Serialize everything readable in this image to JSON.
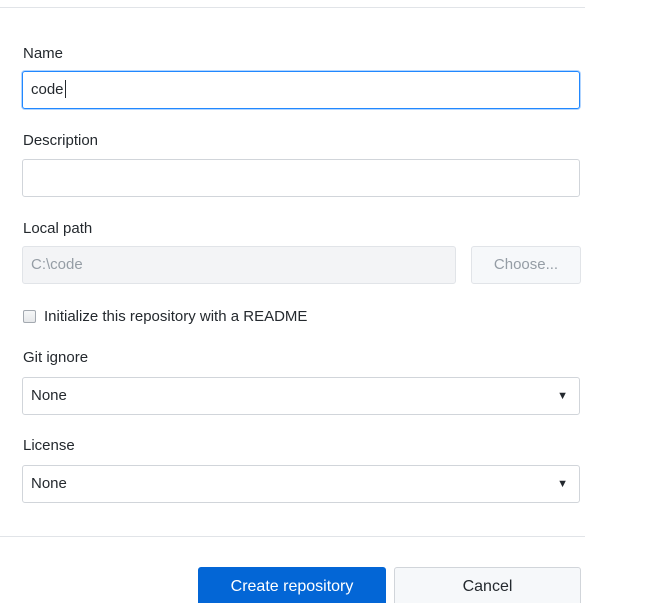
{
  "form": {
    "name": {
      "label": "Name",
      "value": "code"
    },
    "description": {
      "label": "Description",
      "value": ""
    },
    "local_path": {
      "label": "Local path",
      "value": "C:\\code",
      "choose_label": "Choose..."
    },
    "readme": {
      "label": "Initialize this repository with a README",
      "checked": false
    },
    "git_ignore": {
      "label": "Git ignore",
      "selected": "None"
    },
    "license": {
      "label": "License",
      "selected": "None"
    }
  },
  "actions": {
    "create_label": "Create repository",
    "cancel_label": "Cancel"
  },
  "colors": {
    "accent": "#0366d6",
    "focus_border": "#2188ff"
  },
  "icons": {
    "dropdown": "chevron-down-icon"
  }
}
